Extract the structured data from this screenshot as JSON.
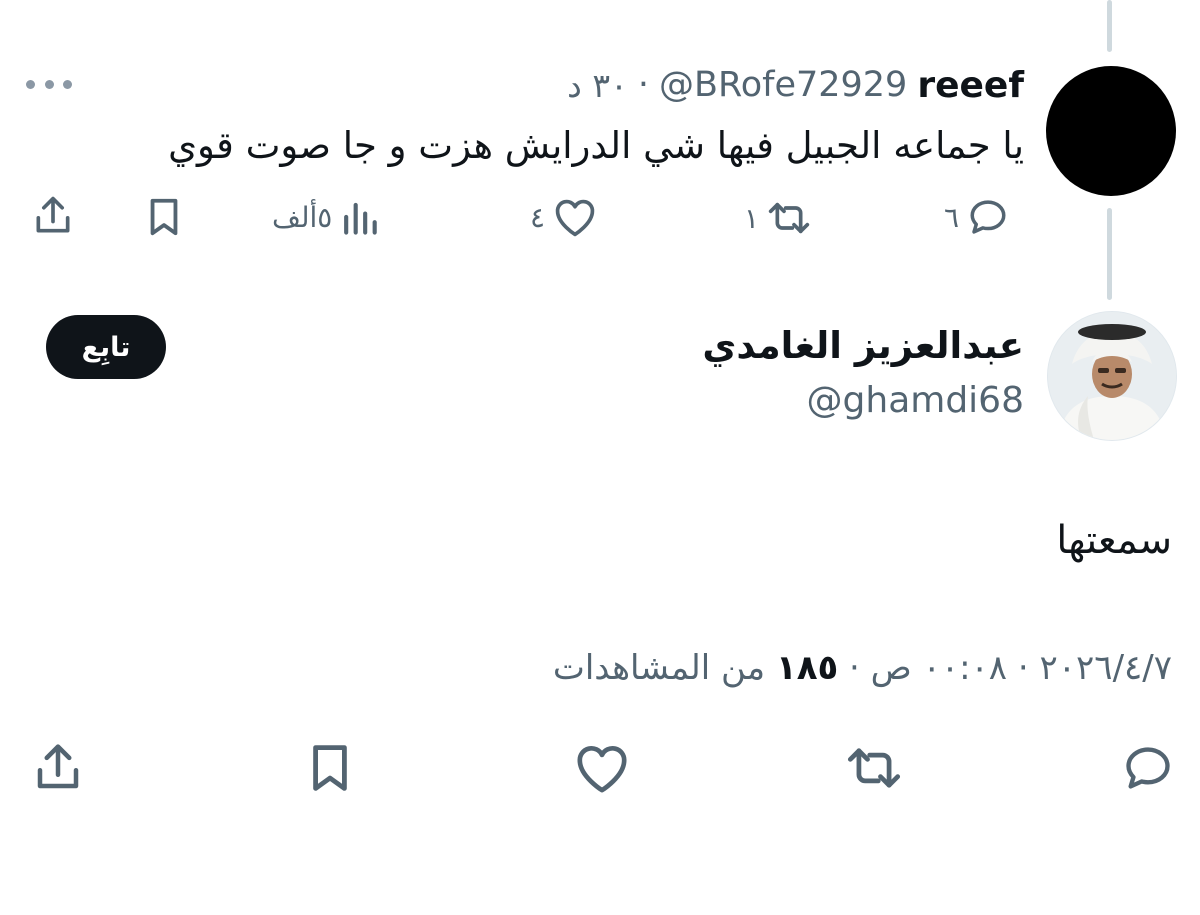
{
  "parent": {
    "display_name": "reeef",
    "handle": "@BRofe72929",
    "separator": "·",
    "time": "٣٠ د",
    "text": "يا جماعه الجبيل فيها شي الدرايش هزت و جا صوت قوي",
    "actions": {
      "replies": "٦",
      "reposts": "١",
      "likes": "٤",
      "views": "٥ألف"
    }
  },
  "reply": {
    "display_name": "عبدالعزيز الغامدي",
    "handle": "@ghamdi68",
    "follow_label": "تابِع",
    "text": "سمعتها",
    "date": "٢٠٢٦/٤/٧",
    "separator": "·",
    "time": "٠٠:٠٨ ص",
    "views_count": "١٨٥",
    "views_label": "من المشاهدات"
  },
  "icons": {
    "reply": "reply-icon",
    "repost": "repost-icon",
    "like": "heart-icon",
    "views": "views-icon",
    "bookmark": "bookmark-icon",
    "share": "share-icon",
    "more": "more-icon"
  },
  "colors": {
    "text_primary": "#0f1419",
    "text_secondary": "#536471",
    "thread_line": "#cfd9de",
    "follow_button_bg": "#0f1419"
  }
}
